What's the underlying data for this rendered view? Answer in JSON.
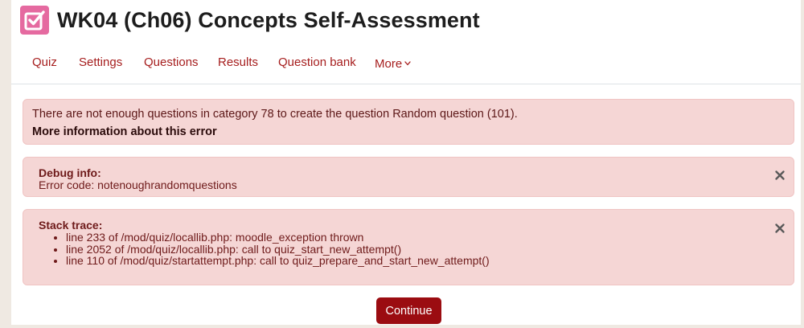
{
  "header": {
    "title": "WK04 (Ch06) Concepts Self-Assessment",
    "icon": "quiz-checkbox-icon",
    "icon_color": "#e56aa0"
  },
  "nav": {
    "items": [
      {
        "label": "Quiz"
      },
      {
        "label": "Settings"
      },
      {
        "label": "Questions"
      },
      {
        "label": "Results"
      },
      {
        "label": "Question bank"
      },
      {
        "label": "More"
      }
    ],
    "more_icon": "chevron-down-icon",
    "link_color": "#a61e1e"
  },
  "error_alert": {
    "message": "There are not enough questions in category 78 to create the question Random question (101).",
    "more_info_link": "More information about this error"
  },
  "debug_alert": {
    "heading": "Debug info:",
    "text": "Error code: notenoughrandomquestions",
    "close_icon": "close-icon"
  },
  "stack_alert": {
    "heading": "Stack trace:",
    "items": [
      "line 233 of /mod/quiz/locallib.php: moodle_exception thrown",
      "line 2052 of /mod/quiz/locallib.php: call to quiz_start_new_attempt()",
      "line 110 of /mod/quiz/startattempt.php: call to quiz_prepare_and_start_new_attempt()"
    ],
    "close_icon": "close-icon"
  },
  "continue_button": {
    "label": "Continue",
    "color": "#9b0c11"
  },
  "colors": {
    "alert_background": "#f5d6d5",
    "alert_text": "#6e1a1a"
  }
}
